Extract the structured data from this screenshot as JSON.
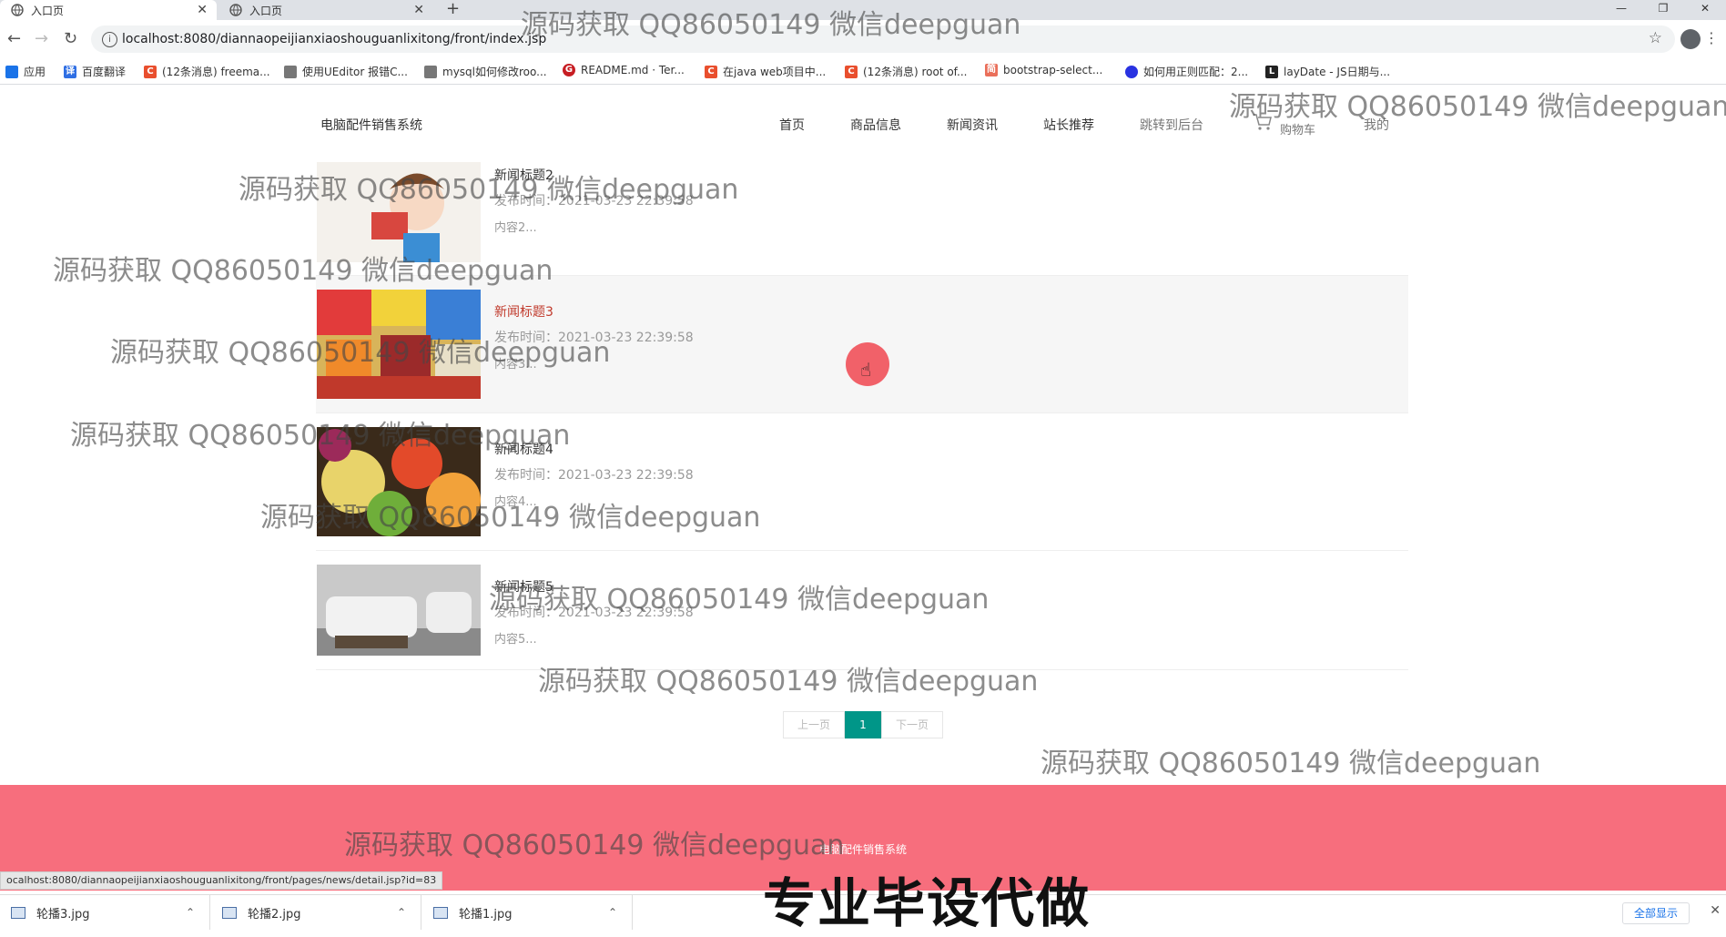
{
  "browser": {
    "tabs": [
      {
        "label": "入口页",
        "active": true
      },
      {
        "label": "入口页",
        "active": false
      }
    ],
    "new_tab": "+",
    "window_controls": [
      "—",
      "❐",
      "✕"
    ],
    "url": "localhost:8080/diannaopeijianxiaoshouguanlixitong/front/index.jsp",
    "bookmarks": [
      {
        "label": "应用",
        "icon": "apps-grid-icon",
        "color": "#1a73e8"
      },
      {
        "label": "百度翻译",
        "icon": "baidu-translate-icon",
        "color": "#2f6fe4"
      },
      {
        "label": "(12条消息) freema...",
        "icon": "csdn-icon",
        "color": "#e94f2e"
      },
      {
        "label": "使用UEditor 报错C...",
        "icon": "bird-icon",
        "color": "#555555"
      },
      {
        "label": "mysql如何修改roo...",
        "icon": "bird-icon",
        "color": "#555555"
      },
      {
        "label": "README.md · Ter...",
        "icon": "gitee-icon",
        "color": "#c71d23"
      },
      {
        "label": "在java web项目中...",
        "icon": "csdn-icon",
        "color": "#e94f2e"
      },
      {
        "label": "(12条消息) root of...",
        "icon": "csdn-icon",
        "color": "#e94f2e"
      },
      {
        "label": "bootstrap-select...",
        "icon": "jianshu-icon",
        "color": "#ea6f5a"
      },
      {
        "label": "如何用正则匹配：2...",
        "icon": "baidu-paw-icon",
        "color": "#2932e1"
      },
      {
        "label": "layDate - JS日期与...",
        "icon": "layui-icon",
        "color": "#222222"
      }
    ]
  },
  "site": {
    "title": "电脑配件销售系统",
    "nav": [
      "首页",
      "商品信息",
      "新闻资讯",
      "站长推荐",
      "跳转到后台",
      "购物车",
      "我的"
    ]
  },
  "news": [
    {
      "title": "新闻标题2",
      "time": "发布时间：2021-03-23 22:39:58",
      "brief": "内容2..."
    },
    {
      "title": "新闻标题3",
      "time": "发布时间：2021-03-23 22:39:58",
      "brief": "内容3..."
    },
    {
      "title": "新闻标题4",
      "time": "发布时间：2021-03-23 22:39:58",
      "brief": "内容4..."
    },
    {
      "title": "新闻标题5",
      "time": "发布时间：2021-03-23 22:39:58",
      "brief": "内容5..."
    }
  ],
  "pager": {
    "prev": "上一页",
    "current": "1",
    "next": "下一页"
  },
  "footer": {
    "title": "电脑配件销售系统"
  },
  "status_url": "ocalhost:8080/diannaopeijianxiaoshouguanlixitong/front/pages/news/detail.jsp?id=83",
  "downloads": {
    "files": [
      "轮播3.jpg",
      "轮播2.jpg",
      "轮播1.jpg"
    ],
    "show_all": "全部显示"
  },
  "watermark": "源码获取 QQ86050149 微信deepguan",
  "promo": "专业毕设代做"
}
